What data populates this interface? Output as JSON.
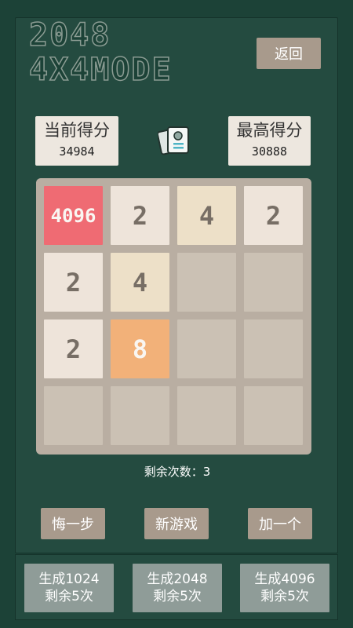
{
  "logo": {
    "line1": "2048",
    "line2": "4X4MODE"
  },
  "back_label": "返回",
  "score": {
    "current_label": "当前得分",
    "current_value": "34984",
    "best_label": "最高得分",
    "best_value": "30888"
  },
  "board": [
    [
      "4096",
      "2",
      "4",
      "2"
    ],
    [
      "2",
      "4",
      "",
      ""
    ],
    [
      "2",
      "8",
      "",
      ""
    ],
    [
      "",
      "",
      "",
      ""
    ]
  ],
  "remaining_text": "剩余次数：3",
  "actions": {
    "undo": "悔一步",
    "new_game": "新游戏",
    "add_one": "加一个"
  },
  "generate": [
    {
      "title": "生成1024",
      "sub": "剩余5次"
    },
    {
      "title": "生成2048",
      "sub": "剩余5次"
    },
    {
      "title": "生成4096",
      "sub": "剩余5次"
    }
  ],
  "colors": {
    "background": "#1c4237",
    "tile_4096": "#ef6b73",
    "tile_8": "#f2b179",
    "tile_4": "#ede0c8",
    "tile_2": "#eee4da"
  }
}
